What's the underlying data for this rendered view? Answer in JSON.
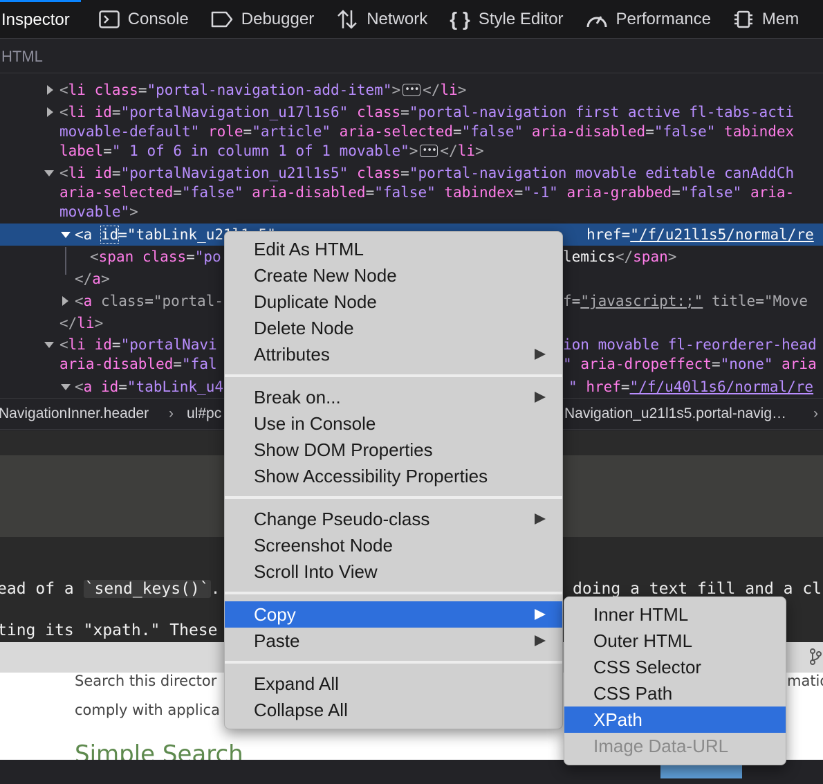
{
  "toolbar": {
    "tabs": [
      {
        "label": "Inspector",
        "icon": "inspector-icon",
        "selected": true
      },
      {
        "label": "Console",
        "icon": "console-icon"
      },
      {
        "label": "Debugger",
        "icon": "debugger-icon"
      },
      {
        "label": "Network",
        "icon": "network-icon"
      },
      {
        "label": "Style Editor",
        "icon": "style-editor-icon"
      },
      {
        "label": "Performance",
        "icon": "performance-icon"
      },
      {
        "label": "Mem",
        "icon": "memory-icon"
      }
    ]
  },
  "panel_header": "HTML",
  "markup": {
    "l0": {
      "tag": "li",
      "an1": "class",
      "av1": "\"portal-navigation-add-item\"",
      "close": "li"
    },
    "l1": {
      "tag": "li",
      "an1": "id",
      "av1": "\"portalNavigation_u17l1s6\"",
      "an2": "class",
      "av2": "\"portal-navigation first active fl-tabs-acti"
    },
    "l2": {
      "av0": "movable-default\"",
      "an1": "role",
      "av1": "\"article\"",
      "an2": "aria-selected",
      "av2": "\"false\"",
      "an3": "aria-disabled",
      "av3": "\"false\"",
      "an4": "tabindex"
    },
    "l3": {
      "an0": "label",
      "av0": "\" 1 of 6 in column 1 of 1 movable\"",
      "close": "li"
    },
    "l4": {
      "tag": "li",
      "an1": "id",
      "av1": "\"portalNavigation_u21l1s5\"",
      "an2": "class",
      "av2": "\"portal-navigation movable editable canAddCh"
    },
    "l5": {
      "an0": "aria-selected",
      "av0": "\"false\"",
      "an1": "aria-disabled",
      "av1": "\"false\"",
      "an2": "tabindex",
      "av2": "\"-1\"",
      "an3": "aria-grabbed",
      "av3": "\"false\"",
      "an4": "aria-"
    },
    "l6": {
      "av0": "movable\""
    },
    "l7": {
      "tag": "a",
      "an1": "id",
      "av1": "\"tabLink_u21l1s5\"",
      "an2": "href",
      "av2": "\"/f/u21l1s5/normal/re"
    },
    "l8": {
      "tag": "span",
      "an1": "class",
      "av1": "\"po",
      "text": "lemics",
      "close": "span"
    },
    "l9": {
      "close": "a"
    },
    "l10": {
      "tag": "a",
      "an1": "class",
      "av1": "\"portal-",
      "an2": "f",
      "av2": "\"javascript:;\"",
      "an3": "title",
      "av3": "\"Move"
    },
    "l11": {
      "close": "li"
    },
    "l12": {
      "tag": "li",
      "an1": "id",
      "av1": "\"portalNavi",
      "tail": "ion movable fl-reorderer-head"
    },
    "l13": {
      "an0": "aria-disabled",
      "av0": "\"fal",
      "av1": "\"",
      "an2": "aria-dropeffect",
      "av2": "\"none\"",
      "an3": "aria"
    },
    "l14": {
      "tag": "a",
      "an1": "id",
      "av1": "\"tabLink_u4",
      "an2": "href",
      "av2": "\"/f/u40l1s6/normal/re"
    }
  },
  "breadcrumbs": {
    "left": "NavigationInner.header",
    "mid": "ul#pc",
    "right": "Navigation_u21l1s5.portal-navig…"
  },
  "page": {
    "line1_left": "ead of a ",
    "line1_code": "`send_keys()`",
    "line1_end": ".",
    "line1_right": "doing a text fill and a cl",
    "line2_left": "ting its \"xpath.\" These",
    "white_line1_left": "Search this director",
    "white_line1_right": "matio",
    "white_line2_left": "comply with applica",
    "heading": "Simple Search"
  },
  "context_menu": {
    "items": [
      {
        "label": "Edit As HTML"
      },
      {
        "label": "Create New Node"
      },
      {
        "label": "Duplicate Node"
      },
      {
        "label": "Delete Node"
      },
      {
        "label": "Attributes",
        "submenu": true
      },
      {
        "label": "Break on...",
        "submenu": true
      },
      {
        "label": "Use in Console"
      },
      {
        "label": "Show DOM Properties"
      },
      {
        "label": "Show Accessibility Properties"
      },
      {
        "label": "Change Pseudo-class",
        "submenu": true
      },
      {
        "label": "Screenshot Node"
      },
      {
        "label": "Scroll Into View"
      },
      {
        "label": "Copy",
        "submenu": true,
        "highlighted": true
      },
      {
        "label": "Paste",
        "submenu": true
      },
      {
        "label": "Expand All"
      },
      {
        "label": "Collapse All"
      }
    ]
  },
  "copy_submenu": {
    "items": [
      {
        "label": "Inner HTML"
      },
      {
        "label": "Outer HTML"
      },
      {
        "label": "CSS Selector"
      },
      {
        "label": "CSS Path"
      },
      {
        "label": "XPath",
        "highlighted": true
      },
      {
        "label": "Image Data-URL",
        "disabled": true
      }
    ]
  },
  "colors": {
    "toolbar_bg": "#18181a",
    "panel_bg": "#232327",
    "selected_row": "#204e8a",
    "tag_pink": "#ff7de9",
    "value_purple": "#b98eff",
    "menu_bg": "#d0d0d0",
    "menu_highlight": "#2e6fdc",
    "tab_accent": "#0a84ff"
  }
}
